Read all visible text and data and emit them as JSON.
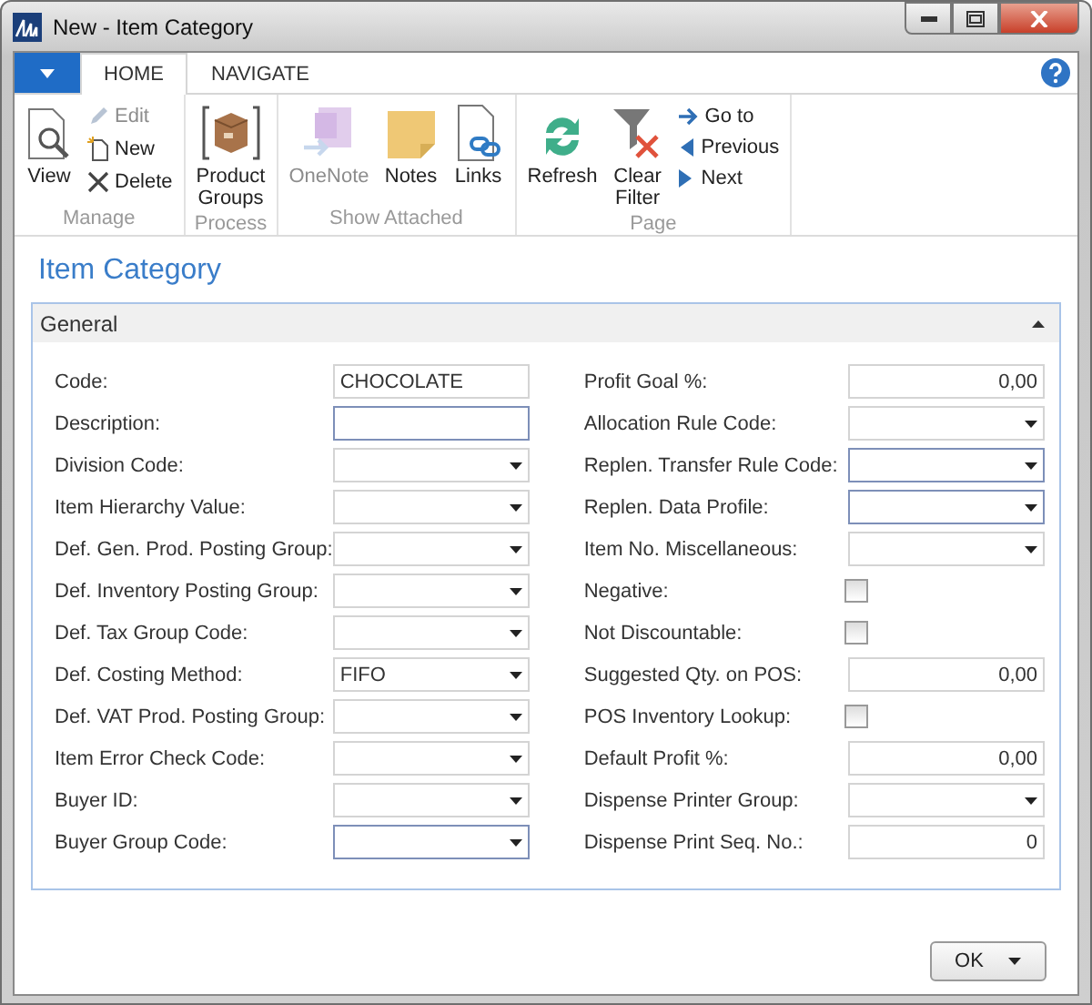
{
  "window": {
    "title": "New - Item Category"
  },
  "ribbon_tabs": [
    {
      "label": "HOME",
      "selected": true
    },
    {
      "label": "NAVIGATE",
      "selected": false
    }
  ],
  "ribbon_groups": [
    {
      "label": "Manage",
      "items": [
        {
          "kind": "large",
          "label": "View",
          "disabled": false
        },
        {
          "kind": "small",
          "label": "Edit",
          "disabled": true
        },
        {
          "kind": "small",
          "label": "New",
          "disabled": false
        },
        {
          "kind": "small",
          "label": "Delete",
          "disabled": false
        }
      ]
    },
    {
      "label": "Process",
      "items": [
        {
          "kind": "large",
          "label": "Product Groups",
          "disabled": false
        }
      ]
    },
    {
      "label": "Show Attached",
      "items": [
        {
          "kind": "large",
          "label": "OneNote",
          "disabled": true
        },
        {
          "kind": "large",
          "label": "Notes",
          "disabled": false
        },
        {
          "kind": "large",
          "label": "Links",
          "disabled": false
        }
      ]
    },
    {
      "label": "Page",
      "items": [
        {
          "kind": "large",
          "label": "Refresh",
          "disabled": false
        },
        {
          "kind": "large",
          "label": "Clear Filter",
          "disabled": false
        },
        {
          "kind": "small",
          "label": "Go to",
          "disabled": false
        },
        {
          "kind": "small",
          "label": "Previous",
          "disabled": false
        },
        {
          "kind": "small",
          "label": "Next",
          "disabled": false
        }
      ]
    }
  ],
  "page": {
    "title": "Item Category"
  },
  "fast_tab": {
    "title": "General",
    "expanded": true,
    "left_fields": [
      {
        "label": "Code:",
        "kind": "text",
        "value": "CHOCOLATE",
        "highlighted": false
      },
      {
        "label": "Description:",
        "kind": "text",
        "highlighted": true
      },
      {
        "label": "Division Code:",
        "kind": "dropdown",
        "highlighted": false
      },
      {
        "label": "Item Hierarchy Value:",
        "kind": "dropdown",
        "highlighted": false
      },
      {
        "label": "Def. Gen. Prod. Posting Group:",
        "kind": "dropdown",
        "highlighted": false
      },
      {
        "label": "Def. Inventory Posting Group:",
        "kind": "dropdown",
        "highlighted": false
      },
      {
        "label": "Def. Tax Group Code:",
        "kind": "dropdown",
        "highlighted": false
      },
      {
        "label": "Def. Costing Method:",
        "kind": "dropdown",
        "value": "FIFO",
        "highlighted": false
      },
      {
        "label": "Def. VAT Prod. Posting Group:",
        "kind": "dropdown",
        "highlighted": false
      },
      {
        "label": "Item Error Check Code:",
        "kind": "dropdown",
        "highlighted": false
      },
      {
        "label": "Buyer ID:",
        "kind": "dropdown",
        "highlighted": false
      },
      {
        "label": "Buyer Group Code:",
        "kind": "dropdown",
        "highlighted": true
      }
    ],
    "right_fields": [
      {
        "label": "Profit Goal %:",
        "kind": "number",
        "value": "0,00",
        "highlighted": false
      },
      {
        "label": "Allocation Rule Code:",
        "kind": "dropdown",
        "highlighted": false
      },
      {
        "label": "Replen. Transfer Rule Code:",
        "kind": "dropdown",
        "highlighted": true
      },
      {
        "label": "Replen. Data Profile:",
        "kind": "dropdown",
        "highlighted": true
      },
      {
        "label": "Item No. Miscellaneous:",
        "kind": "dropdown",
        "highlighted": false
      },
      {
        "label": "Negative:",
        "kind": "checkbox",
        "checked": false
      },
      {
        "label": "Not Discountable:",
        "kind": "checkbox",
        "checked": false
      },
      {
        "label": "Suggested Qty. on POS:",
        "kind": "number",
        "value": "0,00",
        "highlighted": false
      },
      {
        "label": "POS Inventory Lookup:",
        "kind": "checkbox",
        "checked": false
      },
      {
        "label": "Default Profit %:",
        "kind": "number",
        "value": "0,00",
        "highlighted": false
      },
      {
        "label": "Dispense Printer Group:",
        "kind": "dropdown",
        "highlighted": false
      },
      {
        "label": "Dispense Print Seq. No.:",
        "kind": "number",
        "value": "0",
        "highlighted": false
      }
    ]
  },
  "buttons": [
    {
      "label": "OK"
    }
  ]
}
